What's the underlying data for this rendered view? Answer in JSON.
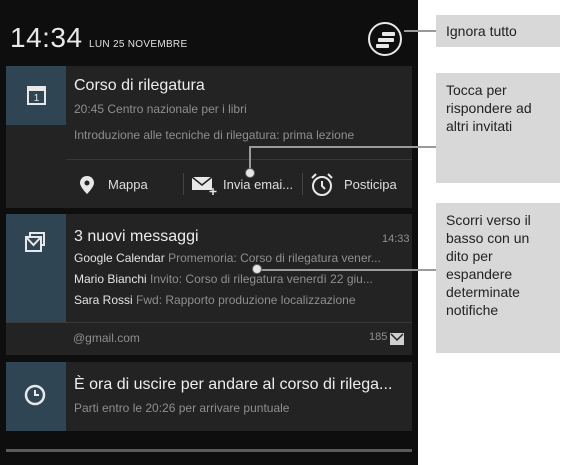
{
  "status": {
    "time": "14:34",
    "date": "LUN 25 NOVEMBRE",
    "clear_all_icon": "clear-all-icon"
  },
  "calendar_notification": {
    "icon": "calendar-icon",
    "title": "Corso di rilegatura",
    "subtitle": "20:45 Centro nazionale per i libri",
    "description": "Introduzione alle tecniche di rilegatura: prima lezione",
    "actions": [
      {
        "icon": "map-pin-icon",
        "label": "Mappa"
      },
      {
        "icon": "email-add-icon",
        "label": "Invia emai..."
      },
      {
        "icon": "alarm-clock-icon",
        "label": "Posticipa"
      }
    ]
  },
  "gmail_notification": {
    "icon": "gmail-stack-icon",
    "title": "3 nuovi messaggi",
    "time": "14:33",
    "messages": [
      {
        "from": "Google Calendar",
        "subject": "Promemoria: Corso di rilegatura vener..."
      },
      {
        "from": "Mario Bianchi",
        "subject": "Invito: Corso di rilegatura venerdì 22 giu..."
      },
      {
        "from": "Sara Rossi",
        "subject": "Fwd: Rapporto produzione localizzazione"
      }
    ],
    "account": "@gmail.com",
    "count": "185"
  },
  "clock_notification": {
    "icon": "clock-icon",
    "title": "È ora di uscire per andare al corso di rilega...",
    "subtitle": "Parti entro le 20:26 per arrivare puntuale"
  },
  "callouts": {
    "dismiss": "Ignora tutto",
    "reply": "Tocca per rispondere ad altri invitati",
    "expand": "Scorri verso il basso con un dito per espandere determinate notifiche"
  },
  "colors": {
    "panel_bg": "#0e0e0e",
    "card_bg": "#232323",
    "icon_box": "#2f4554",
    "callout_bg": "#d8d8d8"
  }
}
